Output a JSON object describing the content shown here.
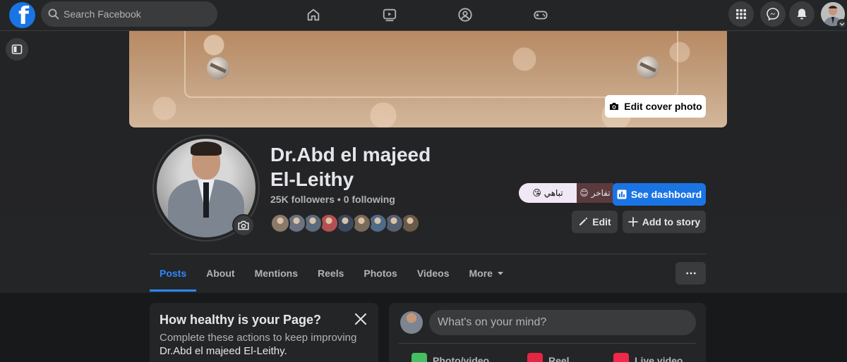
{
  "topbar": {
    "logo_letter": "f",
    "search_placeholder": "Search Facebook",
    "nav_icons": [
      "home-icon",
      "video-icon",
      "groups-icon",
      "gaming-icon"
    ],
    "right_icons": [
      "menu-grid-icon",
      "messenger-icon",
      "notifications-icon"
    ],
    "brand_color": "#1b74e4"
  },
  "cover": {
    "edit_label": "Edit cover photo"
  },
  "profile": {
    "name_line1": "Dr.Abd el majeed",
    "name_line2": "El-Leithy",
    "followers": "25K followers • 0 following",
    "mood_label_1": "😘 تباهي",
    "mood_label_2": "😊 تفاخر",
    "dashboard_label": "See dashboard",
    "edit_label": "Edit",
    "add_story_label": "Add to story",
    "friend_colors": [
      "#8a7a6a",
      "#6b7280",
      "#5a6b7c",
      "#b55050",
      "#3d4a5e",
      "#7a6a5a",
      "#4f6b8a",
      "#556070",
      "#6a5a4a"
    ]
  },
  "tabs": [
    {
      "label": "Posts",
      "active": true
    },
    {
      "label": "About",
      "active": false
    },
    {
      "label": "Mentions",
      "active": false
    },
    {
      "label": "Reels",
      "active": false
    },
    {
      "label": "Photos",
      "active": false
    },
    {
      "label": "Videos",
      "active": false
    },
    {
      "label": "More",
      "active": false
    }
  ],
  "health_card": {
    "title": "How healthy is your Page?",
    "desc": "Complete these actions to keep improving",
    "desc_name": "Dr.Abd el majeed El-Leithy."
  },
  "composer": {
    "placeholder": "What's on your mind?",
    "actions": [
      "Photo/video",
      "Reel",
      "Live video"
    ]
  }
}
